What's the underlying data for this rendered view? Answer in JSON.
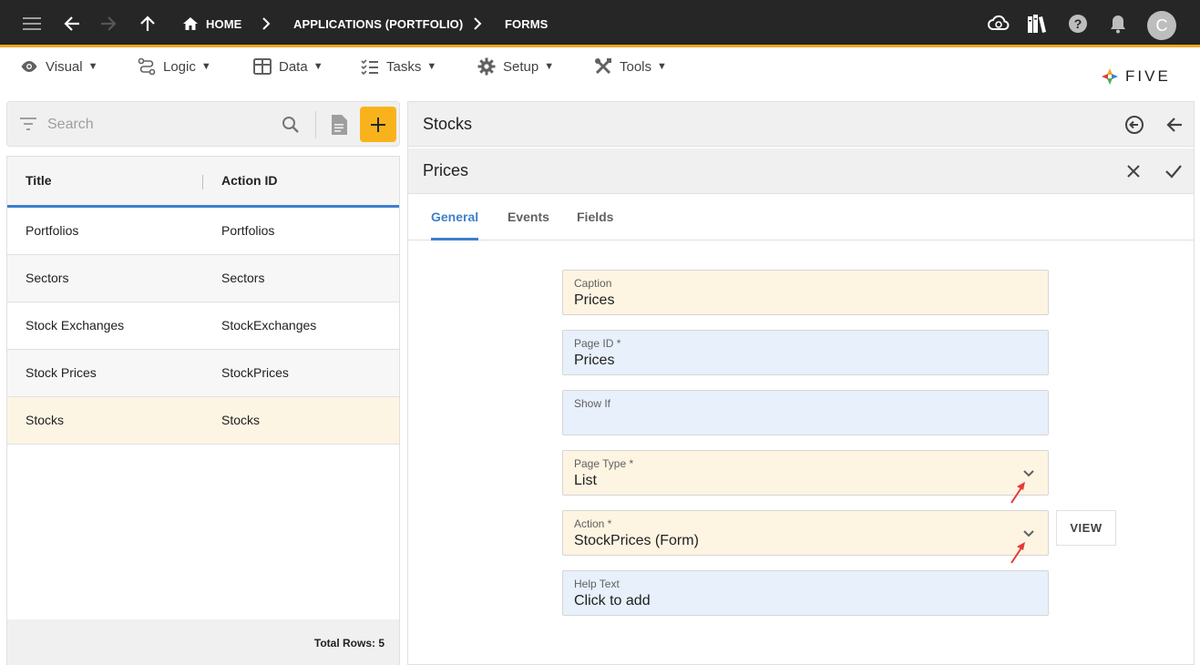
{
  "topbar": {
    "crumbs": [
      "HOME",
      "APPLICATIONS (PORTFOLIO)",
      "FORMS"
    ],
    "avatar_initial": "C"
  },
  "menu": {
    "items": [
      "Visual",
      "Logic",
      "Data",
      "Tasks",
      "Setup",
      "Tools"
    ],
    "caret": "▼"
  },
  "logo": {
    "text": "FIVE"
  },
  "search": {
    "placeholder": "Search"
  },
  "list": {
    "columns": [
      "Title",
      "Action ID"
    ],
    "rows": [
      {
        "title": "Portfolios",
        "action_id": "Portfolios"
      },
      {
        "title": "Sectors",
        "action_id": "Sectors"
      },
      {
        "title": "Stock Exchanges",
        "action_id": "StockExchanges"
      },
      {
        "title": "Stock Prices",
        "action_id": "StockPrices"
      },
      {
        "title": "Stocks",
        "action_id": "Stocks"
      }
    ],
    "footer": "Total Rows: 5"
  },
  "detail": {
    "parent_title": "Stocks",
    "title": "Prices",
    "tabs": [
      "General",
      "Events",
      "Fields"
    ],
    "active_tab": "General",
    "fields": {
      "caption": {
        "label": "Caption",
        "value": "Prices"
      },
      "page_id": {
        "label": "Page ID *",
        "value": "Prices"
      },
      "show_if": {
        "label": "Show If",
        "value": ""
      },
      "page_type": {
        "label": "Page Type *",
        "value": "List"
      },
      "action": {
        "label": "Action *",
        "value": "StockPrices (Form)"
      },
      "help_text": {
        "label": "Help Text",
        "value": "Click to add"
      }
    },
    "view_button": "VIEW"
  },
  "colors": {
    "topbar": "#262626",
    "accent": "#f5a623",
    "add_button": "#f8b31c",
    "active_tab": "#3d7fcc",
    "field_yellow": "#fdf4e2",
    "field_blue": "#e7f0fb",
    "selected_row": "#fdf5e3",
    "annotation_arrow": "#e53935"
  }
}
